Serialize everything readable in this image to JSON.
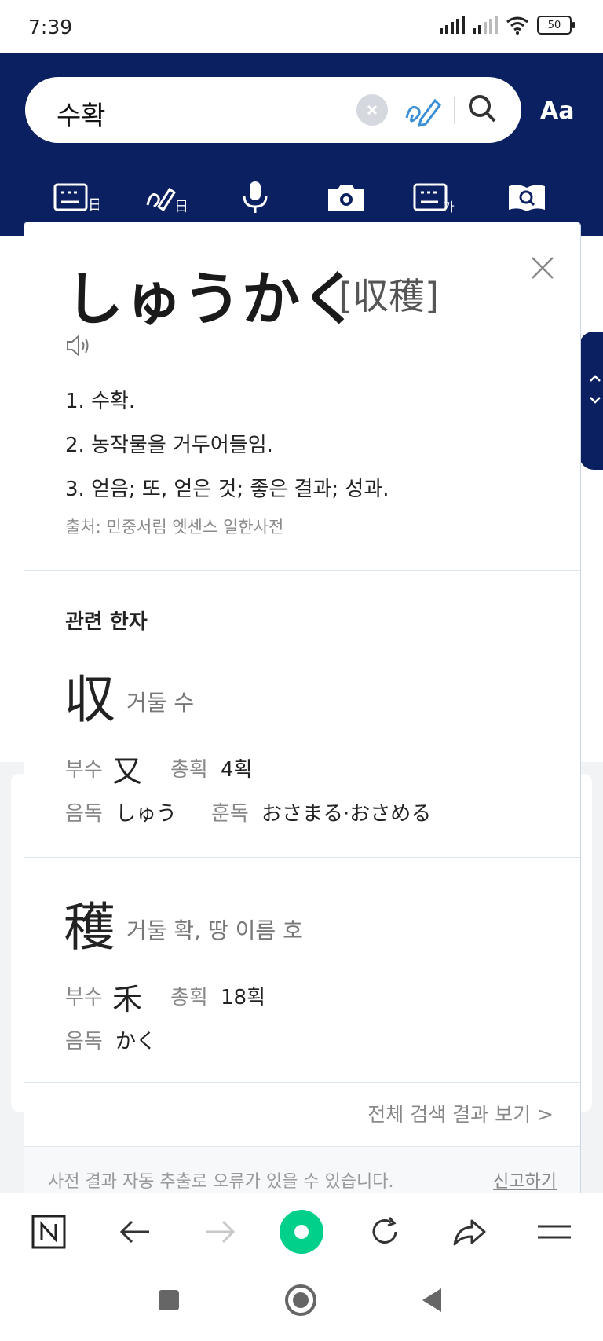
{
  "status": {
    "time": "7:39",
    "battery": "50"
  },
  "search": {
    "query": "수확",
    "font_size_label": "Aa"
  },
  "toolbar": {
    "tools": [
      "keyboard-hanja-icon",
      "handwriting-hanja-icon",
      "microphone-icon",
      "camera-icon",
      "keyboard-korean-icon",
      "book-search-icon"
    ]
  },
  "entry": {
    "headword": "しゅうかく",
    "hanja": "[収穫]",
    "definitions": [
      "1. 수확.",
      "2. 농작물을 거두어들임.",
      "3. 얻음; 또, 얻은 것; 좋은 결과; 성과."
    ],
    "source": "출처: 민중서림 엣센스 일한사전"
  },
  "related": {
    "title": "관련 한자",
    "chars": [
      {
        "char": "収",
        "meaning": "거둘 수",
        "radical_label": "부수",
        "radical": "又",
        "strokes_label": "총획",
        "strokes": "4획",
        "onyomi_label": "음독",
        "onyomi": "しゅう",
        "kunyomi_label": "훈독",
        "kunyomi": "おさまる·おさめる"
      },
      {
        "char": "穫",
        "meaning": "거둘 확, 땅 이름 호",
        "radical_label": "부수",
        "radical": "禾",
        "strokes_label": "총획",
        "strokes": "18획",
        "onyomi_label": "음독",
        "onyomi": "かく"
      }
    ]
  },
  "footer": {
    "all_results": "전체 검색 결과 보기 >",
    "note": "사전 결과 자동 추출로 오류가 있을 수 있습니다.",
    "report": "신고하기"
  },
  "side_tab": {
    "up": "^",
    "down": "v"
  },
  "colors": {
    "header": "#0b2060",
    "accent": "#00d08a"
  }
}
